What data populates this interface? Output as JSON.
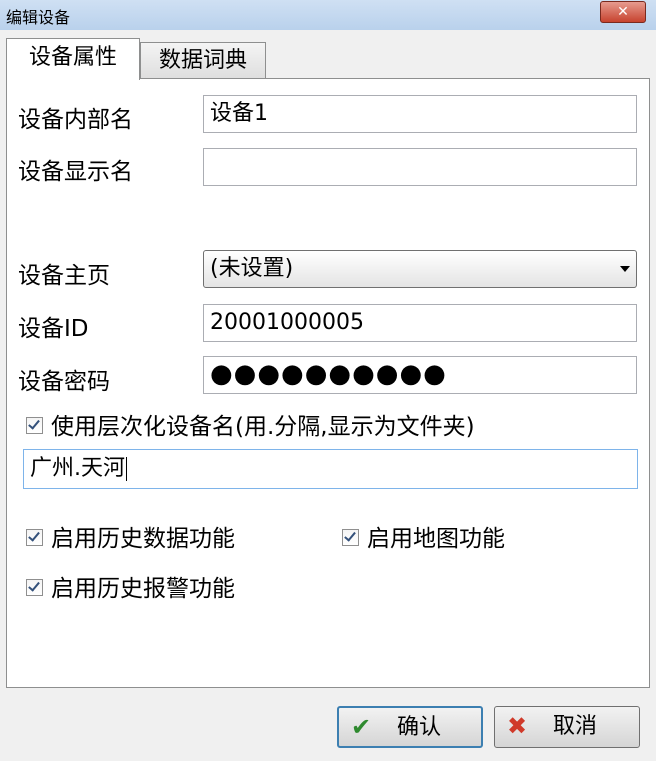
{
  "window": {
    "title": "编辑设备",
    "close_label": "✕"
  },
  "tabs": [
    {
      "label": "设备属性",
      "active": true
    },
    {
      "label": "数据词典",
      "active": false
    }
  ],
  "form": {
    "internal_name_label": "设备内部名",
    "internal_name_value": "设备1",
    "display_name_label": "设备显示名",
    "display_name_value": "",
    "homepage_label": "设备主页",
    "homepage_value": "(未设置)",
    "device_id_label": "设备ID",
    "device_id_value": "20001000005",
    "password_label": "设备密码",
    "password_value": "●●●●●●●●●●",
    "hierarchical_label": "使用层次化设备名(用.分隔,显示为文件夹)",
    "hierarchical_checked": true,
    "hierarchical_value": "广州.天河",
    "history_data_label": "启用历史数据功能",
    "history_data_checked": true,
    "map_label": "启用地图功能",
    "map_checked": true,
    "history_alarm_label": "启用历史报警功能",
    "history_alarm_checked": true
  },
  "buttons": {
    "ok_label": "确认",
    "cancel_label": "取消"
  },
  "icons": {
    "ok": "checkmark-icon",
    "cancel": "x-icon"
  },
  "colors": {
    "title_bar": "#b9d1ec",
    "close_button": "#c7432f",
    "focus_border": "#7eb4ea"
  }
}
